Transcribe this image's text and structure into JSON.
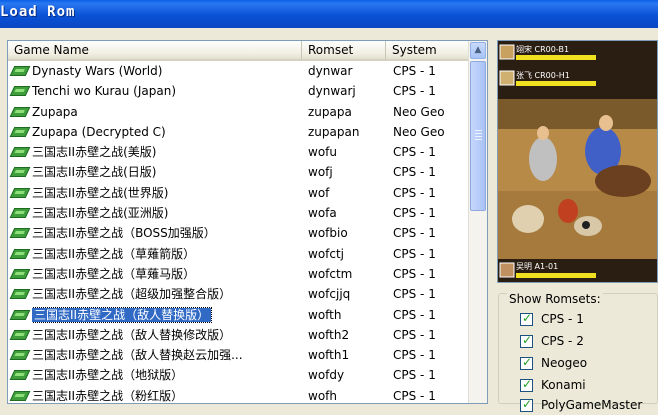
{
  "window": {
    "title": "Load Rom"
  },
  "list": {
    "columns": [
      "Game Name",
      "Romset",
      "System"
    ],
    "rows": [
      {
        "name": "Dynasty Wars (World)",
        "romset": "dynwar",
        "system": "CPS - 1"
      },
      {
        "name": "Tenchi wo Kurau (Japan)",
        "romset": "dynwarj",
        "system": "CPS - 1"
      },
      {
        "name": "Zupapa",
        "romset": "zupapa",
        "system": "Neo Geo"
      },
      {
        "name": "Zupapa (Decrypted C)",
        "romset": "zupapan",
        "system": "Neo Geo"
      },
      {
        "name": "三国志II赤壁之战(美版)",
        "romset": "wofu",
        "system": "CPS - 1"
      },
      {
        "name": "三国志II赤壁之战(日版)",
        "romset": "wofj",
        "system": "CPS - 1"
      },
      {
        "name": "三国志II赤壁之战(世界版)",
        "romset": "wof",
        "system": "CPS - 1"
      },
      {
        "name": "三国志II赤壁之战(亚洲版)",
        "romset": "wofa",
        "system": "CPS - 1"
      },
      {
        "name": "三国志II赤壁之战（BOSS加强版）",
        "romset": "wofbio",
        "system": "CPS - 1"
      },
      {
        "name": "三国志II赤壁之战（草薙箭版）",
        "romset": "wofctj",
        "system": "CPS - 1"
      },
      {
        "name": "三国志II赤壁之战（草薙马版）",
        "romset": "wofctm",
        "system": "CPS - 1"
      },
      {
        "name": "三国志II赤壁之战（超级加强整合版）",
        "romset": "wofcjjq",
        "system": "CPS - 1"
      },
      {
        "name": "三国志II赤壁之战（敌人替换版）",
        "romset": "wofth",
        "system": "CPS - 1",
        "selected": true
      },
      {
        "name": "三国志II赤壁之战（敌人替换修改版）",
        "romset": "wofth2",
        "system": "CPS - 1"
      },
      {
        "name": "三国志II赤壁之战（敌人替换赵云加强...",
        "romset": "wofth1",
        "system": "CPS - 1"
      },
      {
        "name": "三国志II赤壁之战（地狱版）",
        "romset": "wofdy",
        "system": "CPS - 1"
      },
      {
        "name": "三国志II赤壁之战（粉红版）",
        "romset": "wofh",
        "system": "CPS - 1"
      }
    ]
  },
  "preview": {
    "hud_top": "翊宋 CR00-B1",
    "hud_mid": "张飞 CR00-H1",
    "hud_bottom": "吴明 A1-01"
  },
  "romsets": {
    "legend": "Show Romsets:",
    "options": [
      {
        "label": "CPS - 1",
        "checked": true
      },
      {
        "label": "CPS - 2",
        "checked": true
      },
      {
        "label": "Neogeo",
        "checked": true
      },
      {
        "label": "Konami",
        "checked": true
      },
      {
        "label": "PolyGameMaster",
        "checked": true
      }
    ]
  },
  "colors": {
    "titlebar": "#0a52d6",
    "selection": "#316ac5",
    "window_bg": "#ece9d8"
  }
}
